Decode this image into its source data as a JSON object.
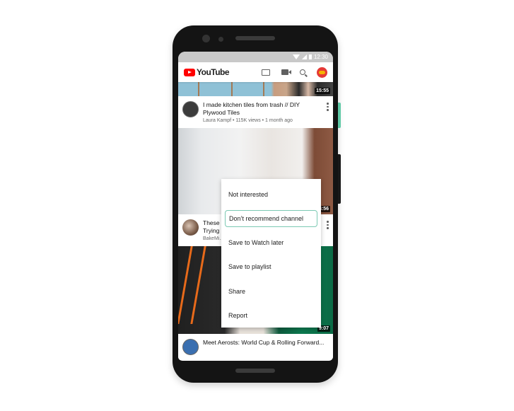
{
  "status_bar": {
    "time": "12:30"
  },
  "app_bar": {
    "brand": "YouTube",
    "icons": [
      "cast-icon",
      "video-camera-icon",
      "search-icon",
      "account-avatar"
    ]
  },
  "feed": {
    "videos": [
      {
        "duration": "15:55",
        "title": "I made kitchen tiles from trash // DIY Plywood Tiles",
        "channel": "Laura Kampf",
        "views": "115K views",
        "age": "1 month ago",
        "subtitle": "Laura Kampf • 115K views • 1 month ago"
      },
      {
        "duration": "14:56",
        "title_partial": "These ... Trying ...",
        "title_line1": "These",
        "title_line2": "Trying",
        "channel_partial": "BakeMi..."
      },
      {
        "duration": "9:07",
        "title_partial": "Meet Aerosts: World Cup & Rolling Forward..."
      }
    ]
  },
  "context_menu": {
    "items": [
      {
        "label": "Not interested",
        "highlighted": false
      },
      {
        "label": "Don’t recommend channel",
        "highlighted": true
      },
      {
        "label": "Save to Watch later",
        "highlighted": false
      },
      {
        "label": "Save to playlist",
        "highlighted": false
      },
      {
        "label": "Share",
        "highlighted": false
      },
      {
        "label": "Report",
        "highlighted": false
      }
    ],
    "highlight_color": "#7cc9b3"
  },
  "colors": {
    "brand_red": "#ff0000",
    "phone_body": "#141414",
    "side_button_accent": "#5fc9a6"
  }
}
